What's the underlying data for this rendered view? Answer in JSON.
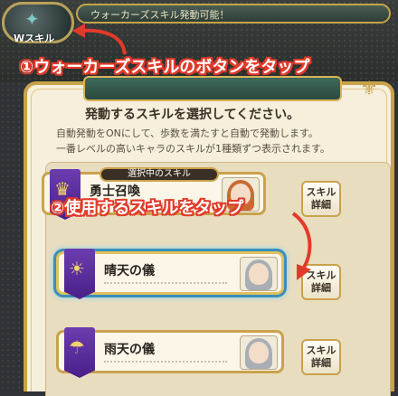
{
  "header": {
    "walker_button_label": "Wスキル",
    "skill_ready_text": "ウォーカーズスキル発動可能！"
  },
  "annotations": {
    "step1": "①ウォーカーズスキルのボタンをタップ",
    "step2": "②使用するスキルをタップ"
  },
  "dialog": {
    "title": "発動するスキルを選択してください。",
    "line1": "自動発動をONにして、歩数を満たすと自動で発動します。",
    "line2": "一番レベルの高いキャラのスキルが1種類ずつ表示されます。",
    "selected_tag": "選択中のスキル",
    "skills": [
      {
        "name": "勇士召喚",
        "detail_label_1": "スキル",
        "detail_label_2": "詳細"
      },
      {
        "name": "晴天の儀",
        "detail_label_1": "スキル",
        "detail_label_2": "詳細"
      },
      {
        "name": "雨天の儀",
        "detail_label_1": "スキル",
        "detail_label_2": "詳細"
      }
    ]
  },
  "colors": {
    "gold_border": "#c9a24c",
    "skill_icon_purple": "#5b2d9c",
    "annotation_red": "#e23a2a",
    "active_glow": "#3b8fb8"
  },
  "icons": {
    "skill_icon": "emblem-icon",
    "arrow": "curved-arrow-icon"
  }
}
